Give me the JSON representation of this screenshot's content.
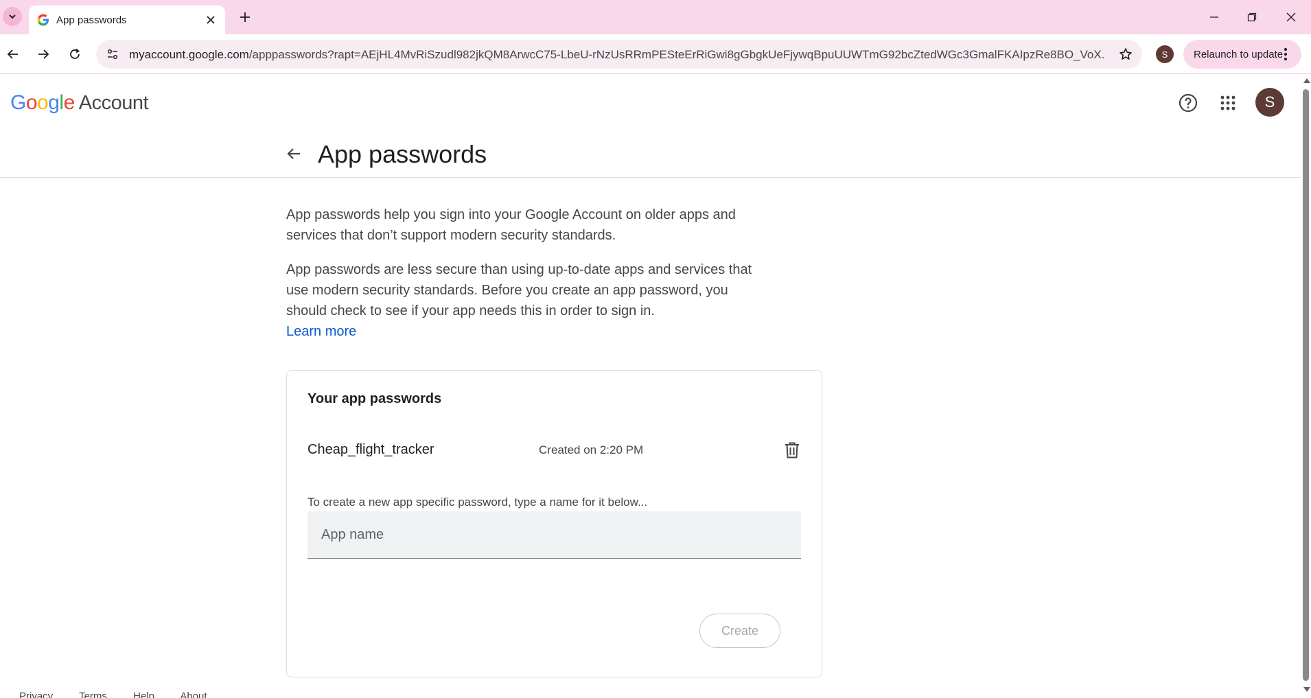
{
  "browser": {
    "tab_title": "App passwords",
    "url_domain": "myaccount.google.com",
    "url_path": "/apppasswords?rapt=AEjHL4MvRiSzudl982jkQM8ArwcC75-LbeU-rNzUsRRmPESteErRiGwi8gGbgkUeFjywqBpuUUWTmG92bcZtedWGc3GmalFKAIpzRe8BO_VoX...",
    "profile_initial": "S",
    "relaunch_label": "Relaunch to update",
    "icons": [
      "tab-search-icon",
      "google-favicon",
      "close-icon",
      "plus-icon",
      "minimize-icon",
      "restore-icon",
      "back-icon",
      "forward-icon",
      "reload-icon",
      "site-info-icon",
      "star-icon",
      "kebab-icon"
    ]
  },
  "header": {
    "logo_text": "Google",
    "logo_suffix": "Account",
    "avatar_initial": "S",
    "icons": [
      "help-icon",
      "apps-grid-icon"
    ]
  },
  "page": {
    "title": "App passwords",
    "intro_1": "App passwords help you sign into your Google Account on older apps and services that don’t support modern security standards.",
    "intro_2": "App passwords are less secure than using up-to-date apps and services that use modern security standards. Before you create an app password, you should check to see if your app needs this in order to sign in.",
    "learn_more": "Learn more"
  },
  "card": {
    "title": "Your app passwords",
    "passwords": [
      {
        "name": "Cheap_flight_tracker",
        "created": "Created on 2:20 PM"
      }
    ],
    "hint": "To create a new app specific password, type a name for it below...",
    "input_placeholder": "App name",
    "input_value": "",
    "create_label": "Create"
  },
  "footer": {
    "links": [
      "Privacy",
      "Terms",
      "Help",
      "About"
    ]
  },
  "colors": {
    "tabstrip": "#f9d8ea",
    "link": "#0b57d0",
    "avatar": "#5d3a34"
  }
}
